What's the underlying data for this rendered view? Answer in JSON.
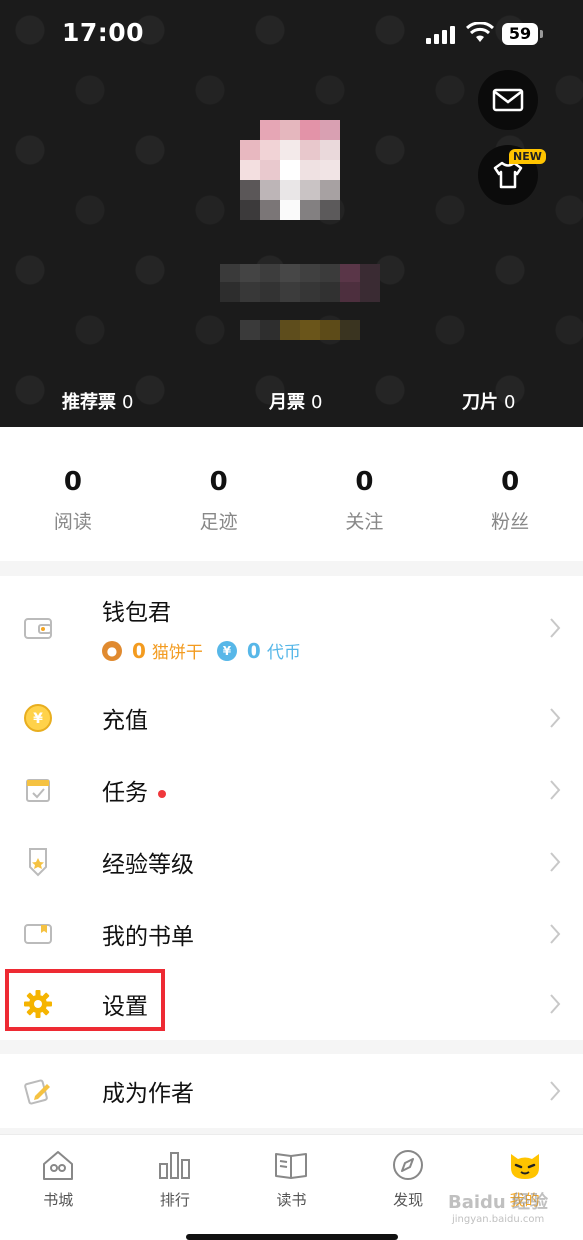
{
  "status": {
    "time": "17:00",
    "battery": "59"
  },
  "header": {
    "new_badge": "NEW",
    "stats": [
      {
        "label": "推荐票",
        "value": "0"
      },
      {
        "label": "月票",
        "value": "0"
      },
      {
        "label": "刀片",
        "value": "0"
      }
    ]
  },
  "counts": [
    {
      "value": "0",
      "label": "阅读"
    },
    {
      "value": "0",
      "label": "足迹"
    },
    {
      "value": "0",
      "label": "关注"
    },
    {
      "value": "0",
      "label": "粉丝"
    }
  ],
  "menu": {
    "wallet": {
      "label": "钱包君",
      "cookies_value": "0",
      "cookies_label": "猫饼干",
      "coins_value": "0",
      "coins_label": "代币",
      "yen_symbol": "¥"
    },
    "recharge": "充值",
    "tasks": "任务",
    "level": "经验等级",
    "booklist": "我的书单",
    "settings": "设置",
    "author": "成为作者"
  },
  "tabs": [
    {
      "label": "书城",
      "icon": "home-icon"
    },
    {
      "label": "排行",
      "icon": "chart-icon"
    },
    {
      "label": "读书",
      "icon": "book-icon"
    },
    {
      "label": "发现",
      "icon": "compass-icon"
    },
    {
      "label": "我的",
      "icon": "cat-icon"
    }
  ],
  "watermark": {
    "main": "Baidu 经验",
    "sub": "jingyan.baidu.com"
  },
  "colors": {
    "accent": "#f5a623",
    "highlight": "#ee2a33",
    "header_bg": "#1b1b1b"
  }
}
